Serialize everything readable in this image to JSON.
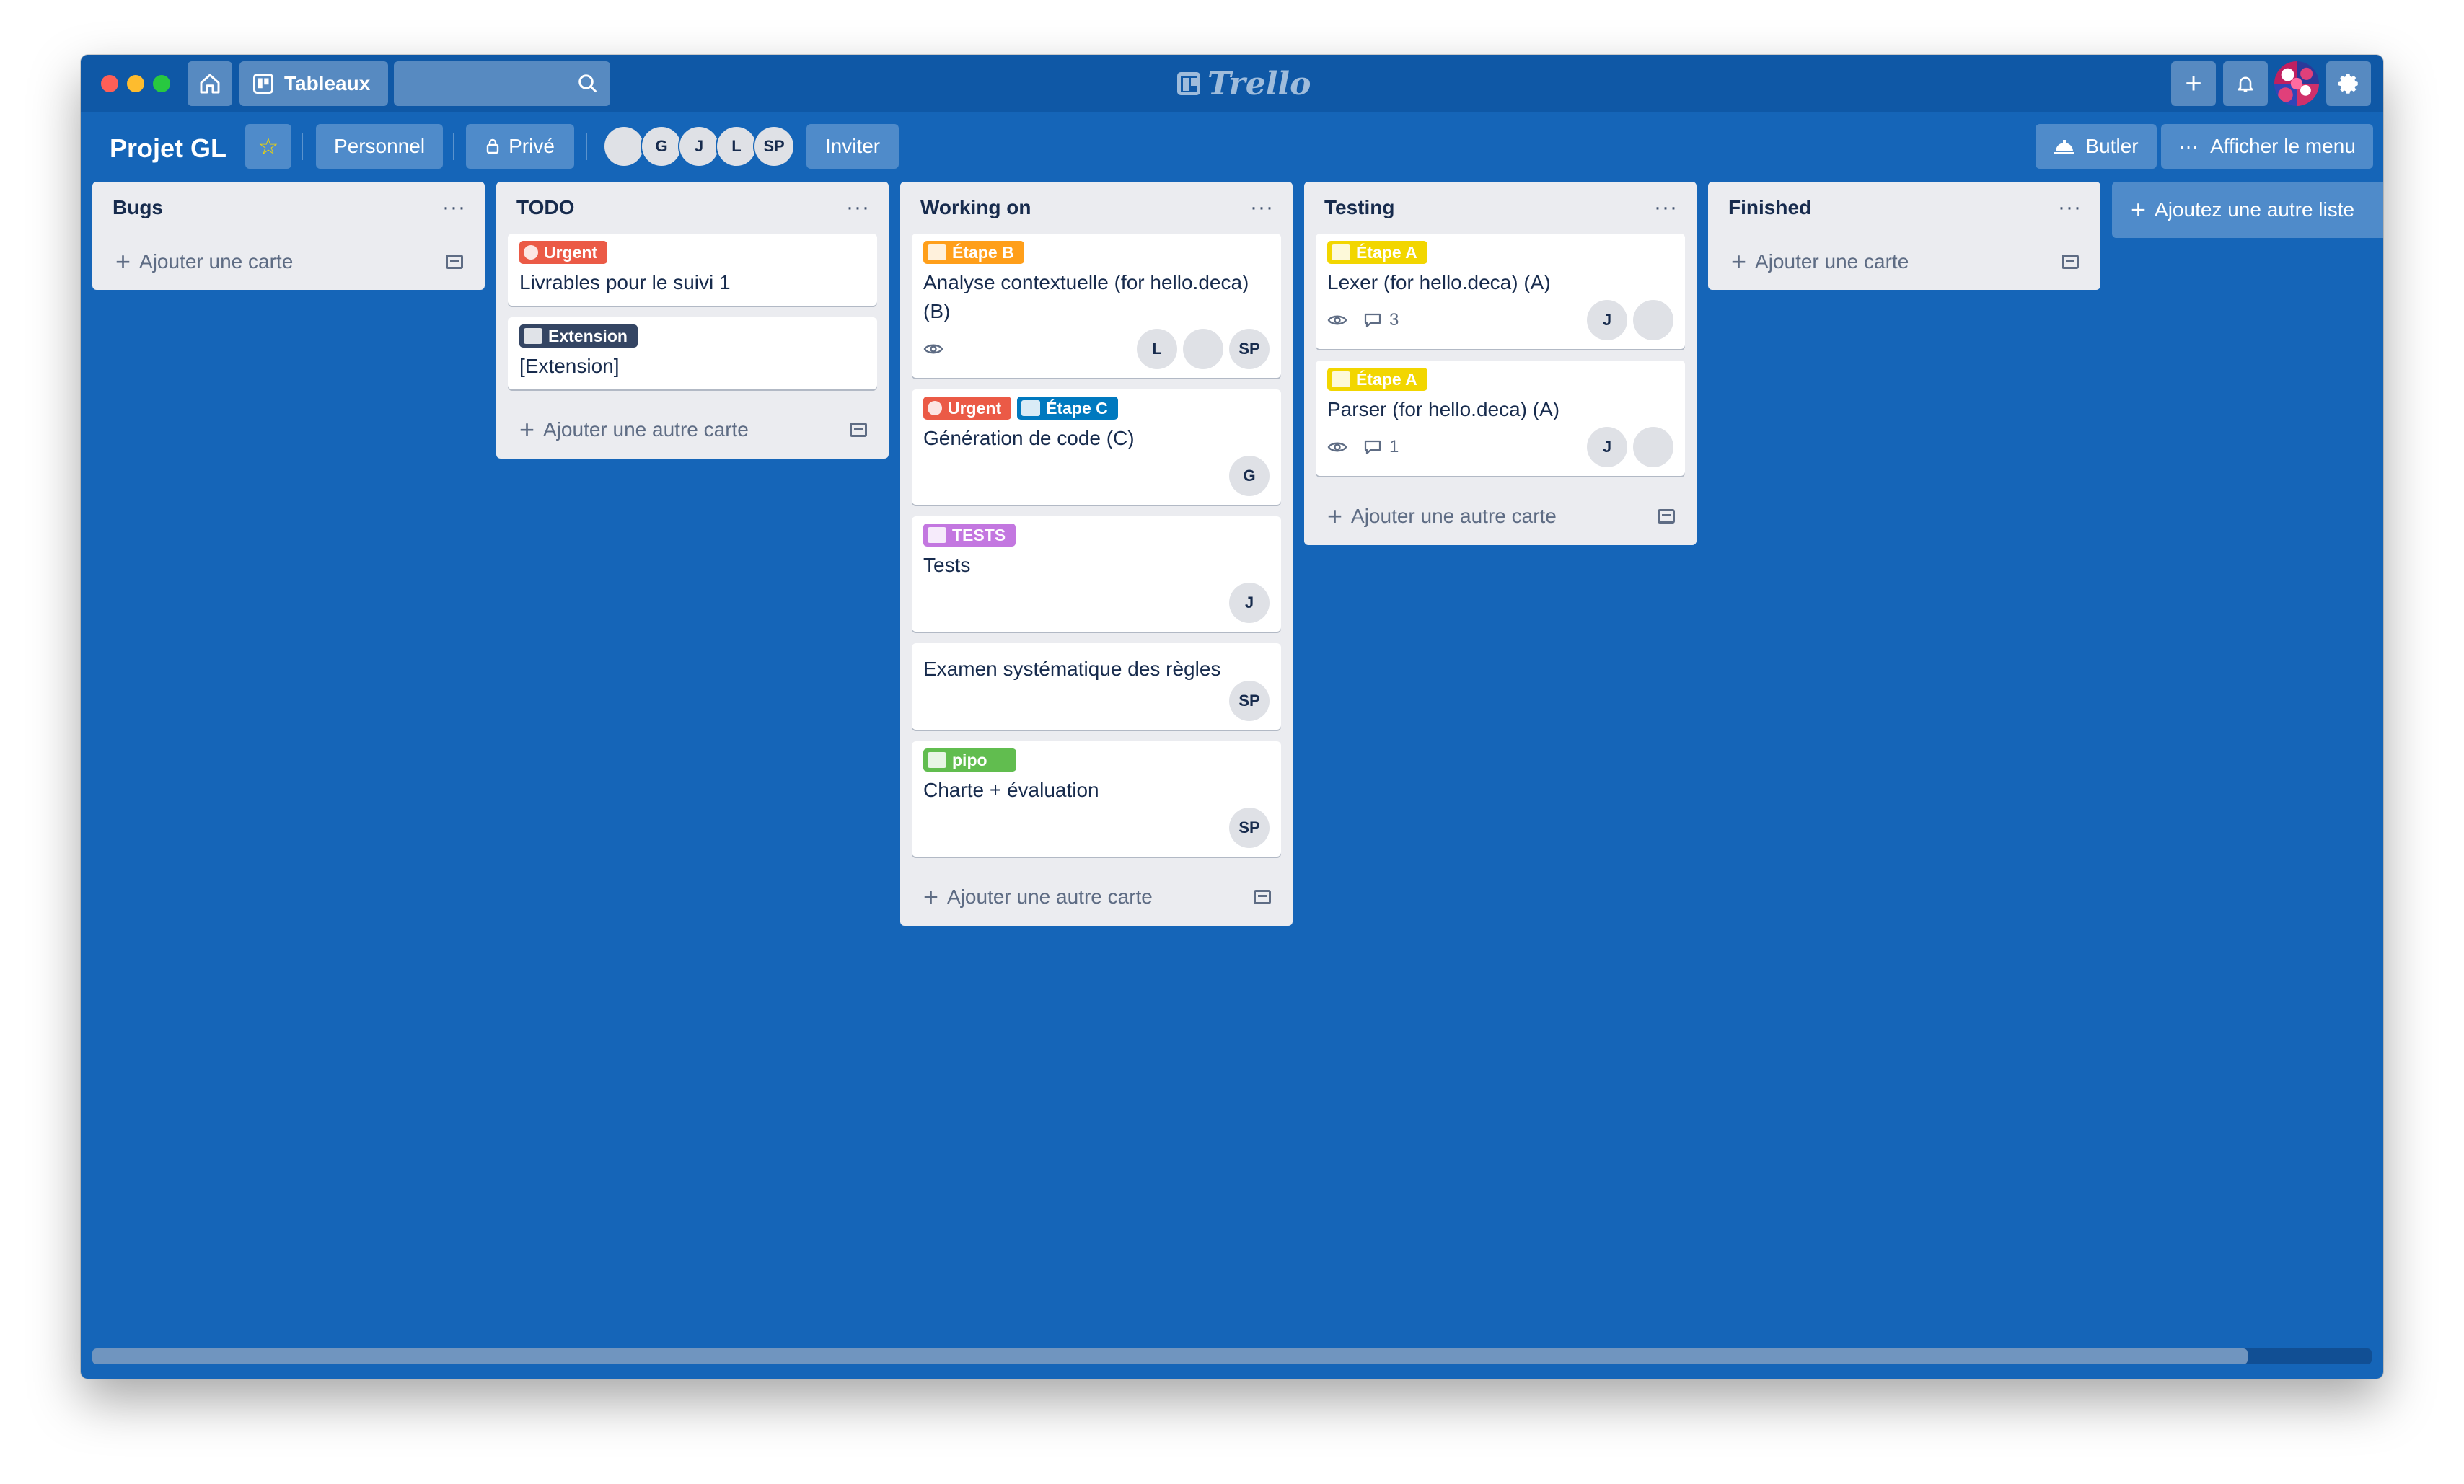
{
  "app": {
    "logo_text": "Trello"
  },
  "topbar": {
    "boards_label": "Tableaux",
    "search_placeholder": "",
    "icons": [
      "home-icon",
      "board-icon",
      "search-icon",
      "plus-icon",
      "bell-icon",
      "settings-icon"
    ]
  },
  "board": {
    "title": "Projet GL",
    "team_label": "Personnel",
    "visibility_label": "Privé",
    "invite_label": "Inviter",
    "butler_label": "Butler",
    "menu_label": "Afficher le menu",
    "members": [
      "G",
      "J",
      "L",
      "SP"
    ]
  },
  "lists": {
    "bugs": {
      "title": "Bugs",
      "menu": "···",
      "add_label": "Ajouter une carte"
    },
    "todo": {
      "title": "TODO",
      "menu": "···",
      "add_label": "Ajouter une autre carte",
      "cards": [
        {
          "label": "Urgent",
          "label_color": "#eb5a46",
          "title": "Livrables pour le suivi 1"
        },
        {
          "label": "Extension",
          "label_color": "#344563",
          "title": "[Extension]"
        }
      ]
    },
    "working": {
      "title": "Working on",
      "menu": "···",
      "add_label": "Ajouter une autre carte",
      "cards": [
        {
          "label": "Étape B",
          "label_color": "#ff9f1a",
          "title": "Analyse contextuelle (for hello.deca) (B)",
          "members": [
            "L",
            "SP"
          ]
        },
        {
          "label": "Urgent",
          "label2": "Étape C",
          "label_color": "#eb5a46",
          "label2_color": "#0079bf",
          "title": "Génération de code (C)",
          "members": [
            "G"
          ]
        },
        {
          "label": "TESTS",
          "label_color": "#c377e0",
          "title": "Tests",
          "members": [
            "J"
          ]
        },
        {
          "title": "Examen systématique des règles",
          "members": [
            "SP"
          ]
        },
        {
          "label": "pipo",
          "label_color": "#61bd4f",
          "title": "Charte + évaluation",
          "members": [
            "SP"
          ]
        }
      ]
    },
    "testing": {
      "title": "Testing",
      "menu": "···",
      "add_label": "Ajouter une autre carte",
      "cards": [
        {
          "label": "Étape A",
          "label_color": "#f2d600",
          "title": "Lexer (for hello.deca) (A)",
          "comments": "3",
          "members": [
            "J"
          ]
        },
        {
          "label": "Étape A",
          "label_color": "#f2d600",
          "title": "Parser (for hello.deca) (A)",
          "comments": "1",
          "members": [
            "J"
          ]
        }
      ]
    },
    "finished": {
      "title": "Finished",
      "menu": "···",
      "add_label": "Ajouter une carte"
    }
  },
  "add_list_label": "Ajoutez une autre liste",
  "colors": {
    "board_bg": "#1565b8",
    "topbar_bg": "#0f58a6",
    "list_bg": "#ebecf0"
  },
  "scroll": {
    "position_fraction": 0.95
  }
}
